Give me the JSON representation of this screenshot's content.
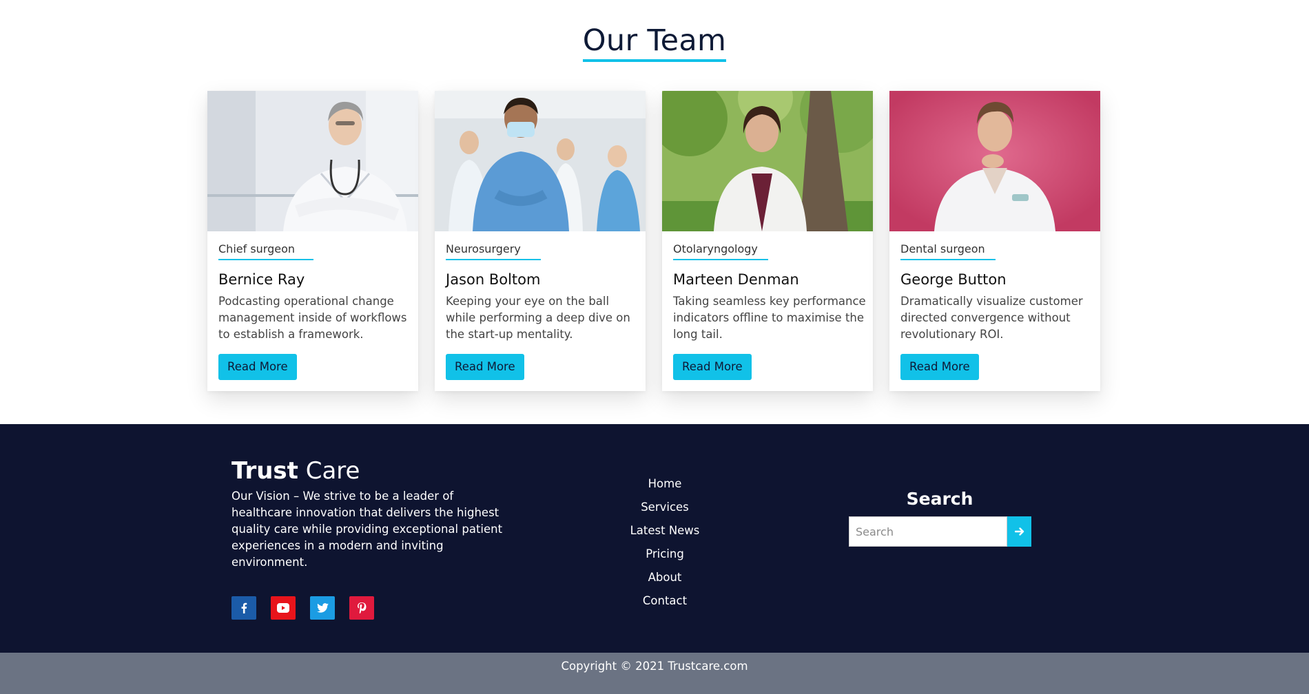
{
  "team": {
    "title": "Our Team",
    "members": [
      {
        "role": "Chief surgeon",
        "name": "Bernice Ray",
        "description": "Podcasting operational change management inside of workflows to establish a framework.",
        "button": "Read More"
      },
      {
        "role": "Neurosurgery",
        "name": "Jason Boltom",
        "description": "Keeping your eye on the ball while performing a deep dive on the start-up mentality.",
        "button": "Read More"
      },
      {
        "role": "Otolaryngology",
        "name": "Marteen Denman",
        "description": "Taking seamless key performance indicators offline to maximise the long tail.",
        "button": "Read More"
      },
      {
        "role": "Dental surgeon",
        "name": "George Button",
        "description": "Dramatically visualize customer directed convergence without revolutionary ROI.",
        "button": "Read More"
      }
    ]
  },
  "footer": {
    "brand_bold": "Trust",
    "brand_light": "Care",
    "vision": "Our Vision – We strive to be a leader of healthcare innovation that delivers the highest quality care while providing exceptional patient experiences in a modern and inviting environment.",
    "socials": [
      {
        "icon": "facebook-icon",
        "color": "#1b5ba8"
      },
      {
        "icon": "youtube-icon",
        "color": "#e8141b"
      },
      {
        "icon": "twitter-icon",
        "color": "#1b9ce3"
      },
      {
        "icon": "pinterest-icon",
        "color": "#e01a3d"
      }
    ],
    "nav": [
      "Home",
      "Services",
      "Latest News",
      "Pricing",
      "About",
      "Contact"
    ],
    "search": {
      "title": "Search",
      "placeholder": "Search"
    },
    "copyright": "Copyright © 2021 Trustcare.com"
  },
  "colors": {
    "accent": "#11c1e8",
    "footer_bg": "#0e1430",
    "copyright_bg": "#6b7383"
  }
}
